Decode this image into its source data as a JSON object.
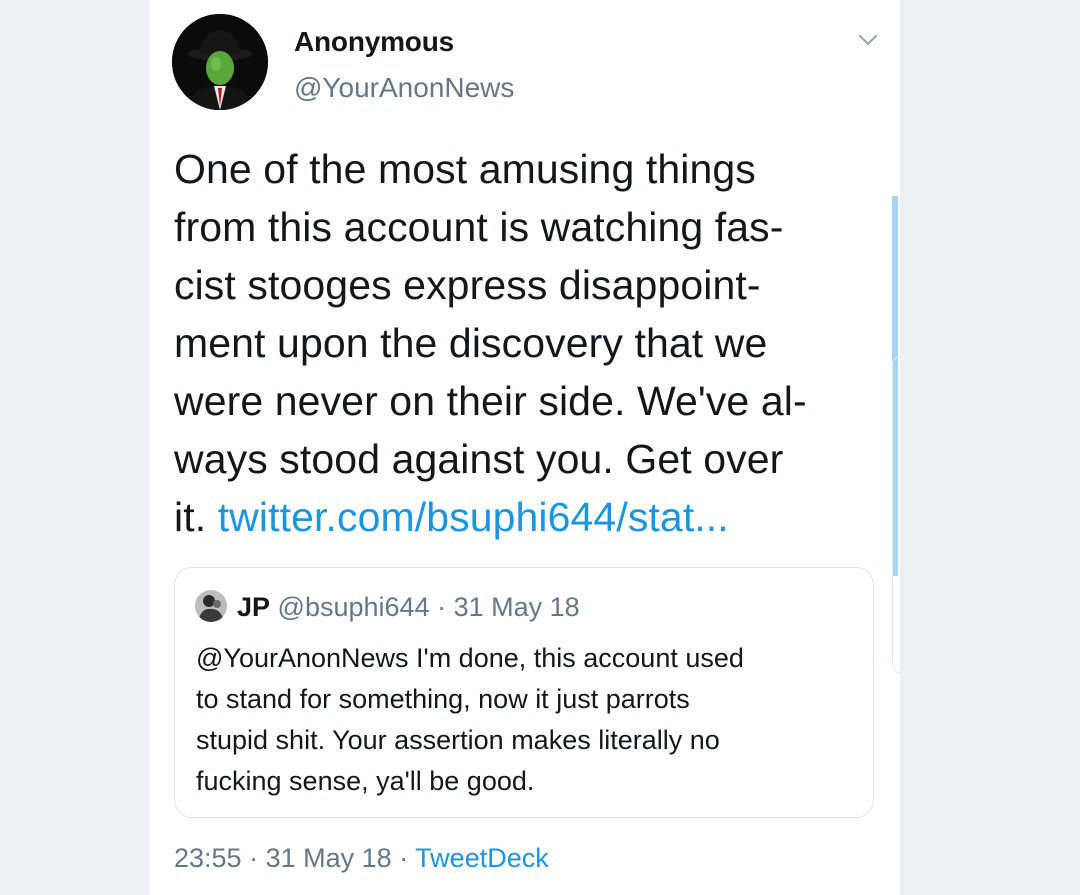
{
  "tweet": {
    "author_name": "Anonymous",
    "author_handle": "@YourAnonNews",
    "text_lines": [
      "One of the most amusing things",
      "from this account is watching fas-",
      "cist stooges express disappoint-",
      "ment upon the discovery that we",
      "were never on their side. We've al-",
      "ways stood against you. Get over",
      "it. "
    ],
    "link_text": "twitter.com/bsuphi644/stat...",
    "menu_icon": "chevron-down-icon",
    "avatar_icon": "masked-figure-avatar"
  },
  "quoted_tweet": {
    "author_name": "JP",
    "author_handle": "@bsuphi644",
    "separator": " · ",
    "date": "31 May 18",
    "text": "@YourAnonNews I'm done, this account used\nto stand for something,  now it just parrots\nstupid shit.  Your assertion makes literally no\nfucking sense, ya'll be good."
  },
  "footer": {
    "time": "23:55",
    "separator": " · ",
    "date": "31 May 18",
    "source": "TweetDeck"
  },
  "colors": {
    "background": "#eef1f4",
    "card": "#ffffff",
    "text": "#14171a",
    "secondary_text": "#657786",
    "link": "#1b95e0",
    "border": "#dde3e8"
  }
}
